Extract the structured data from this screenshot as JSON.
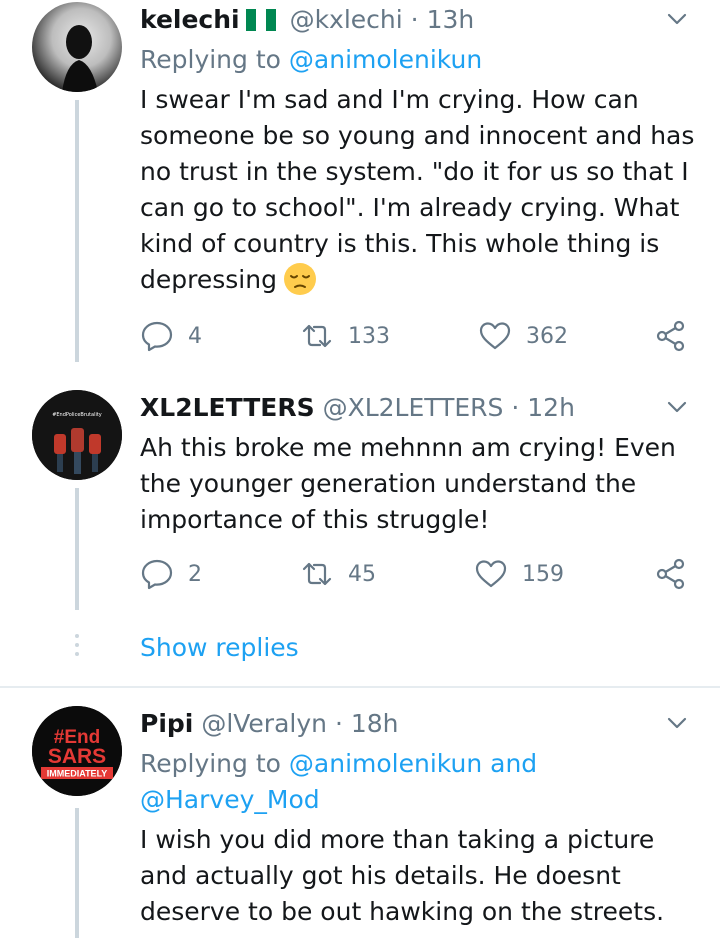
{
  "tweets": [
    {
      "name": "kelechi",
      "handle": "@kxlechi",
      "time": "13h",
      "reply_prefix": "Replying to",
      "reply_to": "@animolenikun",
      "text": "I swear I'm sad and I'm crying. How can someone be so young and innocent and has no trust in the system. \"do it for us so that I can go to school\". I'm already crying. What kind of country is this. This whole thing is depressing",
      "replies": "4",
      "retweets": "133",
      "likes": "362"
    },
    {
      "name": "XL2LETTERS",
      "handle": "@XL2LETTERS",
      "time": "12h",
      "text": "Ah this broke me mehnnn am crying! Even the younger generation understand the importance of this struggle!",
      "replies": "2",
      "retweets": "45",
      "likes": "159",
      "avatar_text": "#EndPoliceBrutality"
    },
    {
      "name": "Pipi",
      "handle": "@lVeralyn",
      "time": "18h",
      "reply_prefix": "Replying to",
      "reply_to": "@animolenikun",
      "reply_and": "and",
      "reply_to_2": "@Harvey_Mod",
      "text": "I wish you did more than taking a picture and actually got his details. He doesnt deserve to be out hawking on the streets.",
      "avatar_lines": [
        "#End",
        "SARS",
        "IMMEDIATELY"
      ]
    }
  ],
  "show_replies": "Show replies",
  "dot_separator": "·",
  "colors": {
    "link": "#1da1f2",
    "secondary": "#657786",
    "line": "#ccd6dd"
  }
}
